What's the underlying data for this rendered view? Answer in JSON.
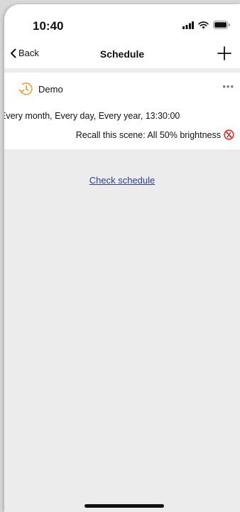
{
  "status": {
    "time": "10:40"
  },
  "nav": {
    "back_label": "Back",
    "title": "Schedule"
  },
  "schedule_item": {
    "name": "Demo",
    "more_label": "•••",
    "schedule_text": "Every month, Every day, Every year, 13:30:00",
    "recall_text": "Recall this scene: All 50% brightness"
  },
  "link": {
    "check_schedule": "Check schedule"
  },
  "colors": {
    "accent_orange": "#e8a23b",
    "link_blue": "#2b3f8f",
    "no_sign_red": "#e53935"
  },
  "icons": {
    "back": "chevron-left-icon",
    "add": "plus-icon",
    "schedule": "clock-icon",
    "recall": "no-sign-icon"
  }
}
